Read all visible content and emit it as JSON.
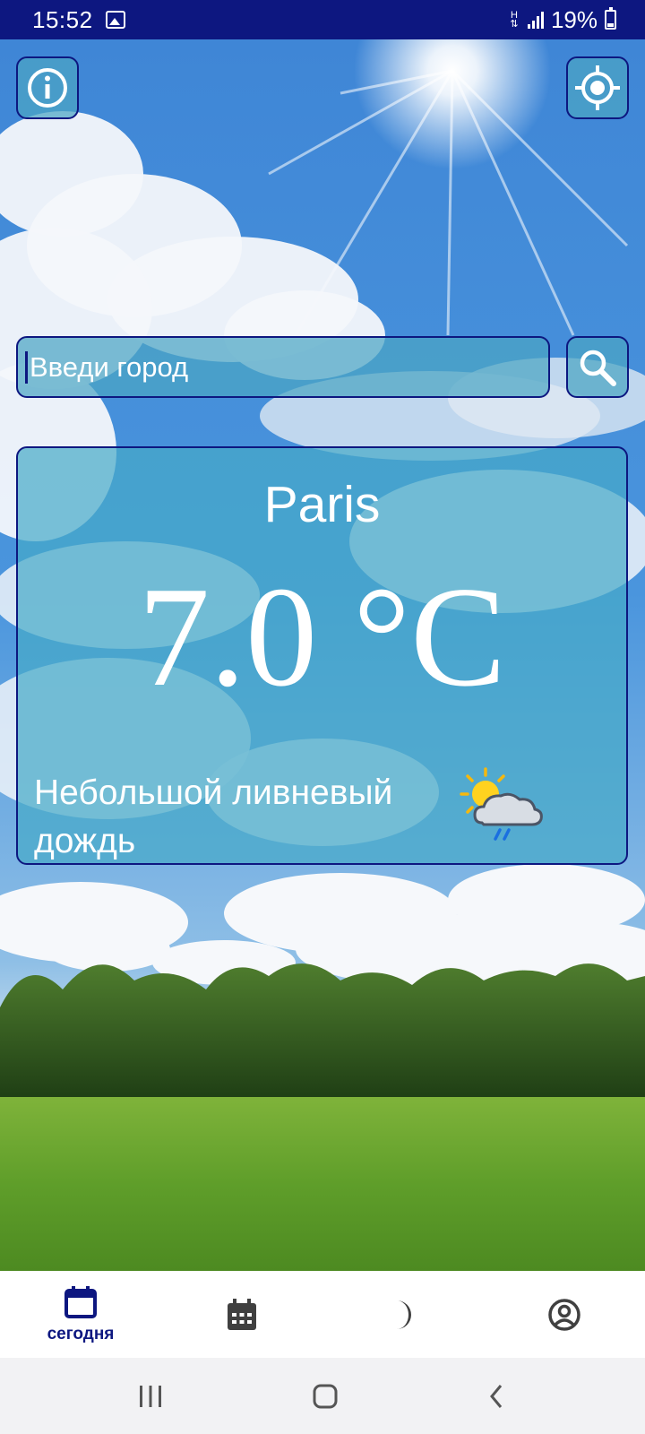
{
  "status_bar": {
    "time": "15:52",
    "network_type": "H",
    "battery": "19%",
    "icons": [
      "gallery-icon",
      "data-arrows-icon",
      "signal-icon",
      "battery-icon"
    ]
  },
  "header": {
    "info_icon": "info-icon",
    "locate_icon": "crosshair-icon"
  },
  "search": {
    "placeholder": "Введи город",
    "value": "",
    "button_icon": "search-icon"
  },
  "weather": {
    "city": "Paris",
    "temperature": "7.0 °C",
    "condition": "Небольшой ливневый дождь",
    "condition_icon": "sun-cloud-rain-icon"
  },
  "bottom_nav": {
    "items": [
      {
        "label": "сегодня",
        "icon": "calendar-today-icon",
        "active": true
      },
      {
        "label": "",
        "icon": "calendar-grid-icon",
        "active": false
      },
      {
        "label": "",
        "icon": "moon-icon",
        "active": false
      },
      {
        "label": "",
        "icon": "account-icon",
        "active": false
      }
    ]
  },
  "system_nav": {
    "icons": [
      "recents-icon",
      "home-icon",
      "back-icon"
    ]
  },
  "colors": {
    "status_bar": "#0d1780",
    "accent": "#0d1780",
    "glass": "#4ba5c3",
    "text_on_glass": "#ffffff"
  }
}
